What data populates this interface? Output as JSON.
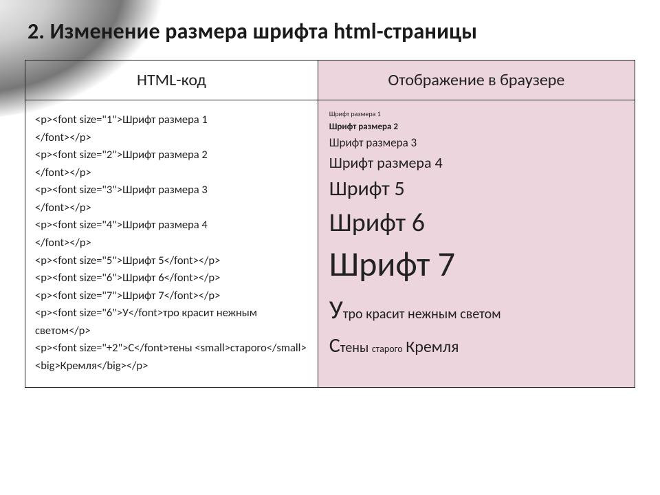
{
  "title": "2. Изменение размера шрифта html-страницы",
  "headers": {
    "left": "HTML-код",
    "right": "Отображение в браузере"
  },
  "code_lines": [
    "<p><font size=\"1\">Шрифт размера 1",
    "</font></p>",
    "<p><font size=\"2\">Шрифт размера 2",
    "</font></p>",
    "<p><font size=\"3\">Шрифт размера 3",
    "</font></p>",
    "<p><font size=\"4\">Шрифт размера 4",
    "</font></p>",
    "<p><font size=\"5\">Шрифт 5</font></p>",
    "<p><font size=\"6\">Шрифт 6</font></p>",
    "<p><font size=\"7\">Шрифт 7</font></p>",
    "<p><font size=\"6\">У</font>тро красит нежным светом</p>",
    "<p><font size=\"+2\">С</font>тены <small>старого</small> <big>Кремля</big></p>"
  ],
  "render": {
    "s1": "Шрифт размера 1",
    "s2": "Шрифт размера  2",
    "s3": "Шрифт размера 3",
    "s4": "Шрифт размера 4",
    "s5": "Шрифт 5",
    "s6": "Шрифт 6",
    "s7": "Шрифт 7",
    "line8_cap": "У",
    "line8_rest": "тро красит нежным светом",
    "line9_cap": "С",
    "line9_a": "тены ",
    "line9_small": "старого",
    "line9_sp": " ",
    "line9_big": "Кремля"
  }
}
